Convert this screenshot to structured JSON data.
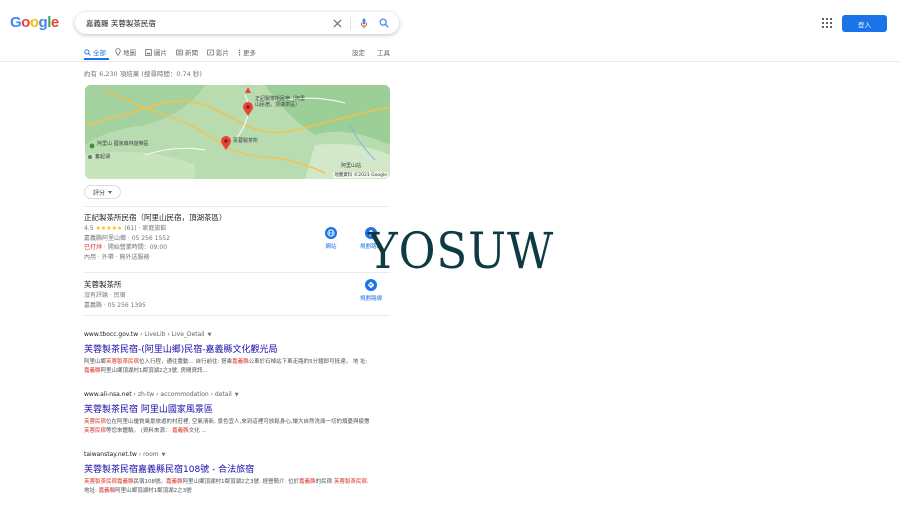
{
  "logo": [
    "G",
    "o",
    "o",
    "g",
    "l",
    "e"
  ],
  "search": {
    "query": "嘉義縣 芙蓉製茶民宿"
  },
  "header": {
    "signin_label": "登入"
  },
  "tabs": [
    {
      "label": "全部",
      "icon": "search-icon",
      "active": true
    },
    {
      "label": "地圖",
      "icon": "map-pin-icon"
    },
    {
      "label": "圖片",
      "icon": "image-icon"
    },
    {
      "label": "新聞",
      "icon": "news-icon"
    },
    {
      "label": "影片",
      "icon": "video-icon"
    },
    {
      "label": "更多",
      "icon": "more-vert-icon"
    }
  ],
  "tools": {
    "settings": "設定",
    "tools": "工具"
  },
  "stats": "約有 6,230 項結果 (搜尋時間：0.74 秒)",
  "map": {
    "place1": "正記製茶所民宿（阿里山民宿，頂湖茶區）",
    "place1_short_a": "正記製茶所民宿（阿里",
    "place1_short_b": "山民宿，頂湖茶區）",
    "place2": "芙蓉製茶所",
    "park_a": "阿里山 國家森林遊樂區",
    "park_b": "森林遊樂區",
    "town": "奮起湖",
    "station": "阿里山站",
    "credit": "地圖資料 ©2021 Google"
  },
  "filter": {
    "label": "評分"
  },
  "businesses": [
    {
      "name": "正記製茶所民宿（阿里山民宿，頂湖茶區）",
      "rating": "4.5",
      "stars": "★★★★★",
      "reviews": "(61)",
      "category": "· 家庭旅館",
      "address": "嘉義縣阿里山鄉 · 05 256 1552",
      "status": "已打烊",
      "hours": " · 開始營業時間：09:00",
      "services": "內用 · 外帶 · 無外送服務",
      "website_label": "網站",
      "directions_label": "規劃路線"
    },
    {
      "name": "芙蓉製茶所",
      "category": "沒有評論 · 民宿",
      "address": "嘉義縣 · 05 256 1395",
      "directions_label": "規劃路線"
    }
  ],
  "results": [
    {
      "domain": "www.tbocc.gov.tw",
      "path": " › LiveLib › Live_Detail",
      "title": "芙蓉製茶民宿-(阿里山鄉)民宿-嘉義縣文化觀光局",
      "snippet_parts": [
        {
          "t": "阿里山鄉"
        },
        {
          "t": "芙蓉製茶民宿",
          "h": true
        },
        {
          "t": "位入行程，通往農動... 自行前往: 搭乘"
        },
        {
          "t": "嘉義縣",
          "h": true
        },
        {
          "t": "公車於石棹站下車走路約5分鐘即可抵達。 地 址: "
        },
        {
          "t": "嘉義縣",
          "h": true
        },
        {
          "t": "阿里山鄉頂湖村1鄰頂湖2之3號, 房間資訊..."
        }
      ]
    },
    {
      "domain": "www.ali-nsa.net",
      "path": " › zh-tw › accommodation › detail",
      "title": "芙蓉製茶民宿 阿里山國家風景區",
      "snippet_parts": [
        {
          "t": "芙蓉民宿",
          "h": true
        },
        {
          "t": "位在阿里山優質風景旅遊的村莊裡, 空氣清新, 景色宜人,來到這裡可放鬆身心,讓大自然洗滌一切的煩憂與疲憊"
        },
        {
          "t": "芙蓉民宿",
          "h": true
        },
        {
          "t": "等您來體驗。 (資料來源： "
        },
        {
          "t": "嘉義縣",
          "h": true
        },
        {
          "t": "文化 ..."
        }
      ]
    },
    {
      "domain": "taiwanstay.net.tw",
      "path": " › room",
      "title": "芙蓉製茶民宿嘉義縣民宿108號 - 合法旅宿",
      "snippet_parts": [
        {
          "t": "芙蓉製茶民宿",
          "h": true
        },
        {
          "t": "嘉義縣",
          "h": true
        },
        {
          "t": "民宿108號。"
        },
        {
          "t": "嘉義縣",
          "h": true
        },
        {
          "t": "阿里山鄉頂湖村1鄰頂湖2之3號. 經營簡介. 位於"
        },
        {
          "t": "嘉義縣",
          "h": true
        },
        {
          "t": "的民宿 "
        },
        {
          "t": "芙蓉製茶民宿",
          "h": true
        },
        {
          "t": ". 地址: "
        },
        {
          "t": "嘉義縣",
          "h": true
        },
        {
          "t": "阿里山鄉頂湖村1鄰頂湖2之3號"
        }
      ]
    }
  ],
  "watermark": "YOSUW",
  "colors": {
    "link": "#1a0dab",
    "accent": "#1a73e8",
    "highlight": "#d93025",
    "star": "#fbbc05"
  }
}
